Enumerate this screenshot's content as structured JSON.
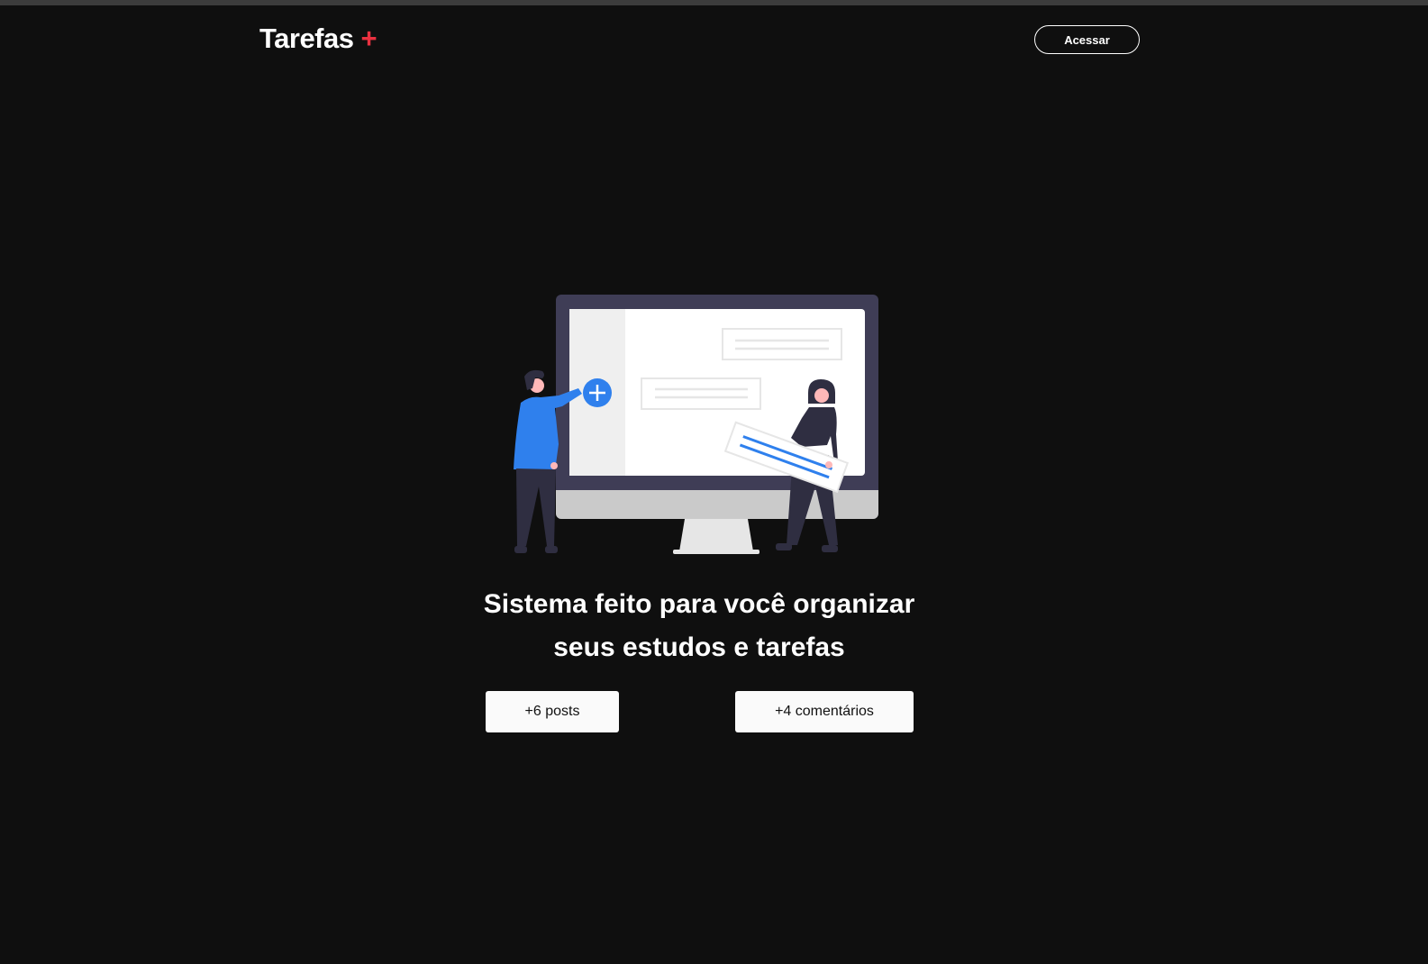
{
  "header": {
    "logo_text": "Tarefas",
    "logo_accent": "+",
    "login_label": "Acessar"
  },
  "hero": {
    "headline_line1": "Sistema feito para você organizar",
    "headline_line2": "seus estudos e tarefas",
    "illustration_icon": "plus-circle-icon"
  },
  "stats": [
    {
      "label": "+6 posts"
    },
    {
      "label": "+4 comentários"
    }
  ],
  "colors": {
    "background": "#0f0f0f",
    "accent": "#ea3140",
    "illustration_blue": "#2f80ed"
  }
}
